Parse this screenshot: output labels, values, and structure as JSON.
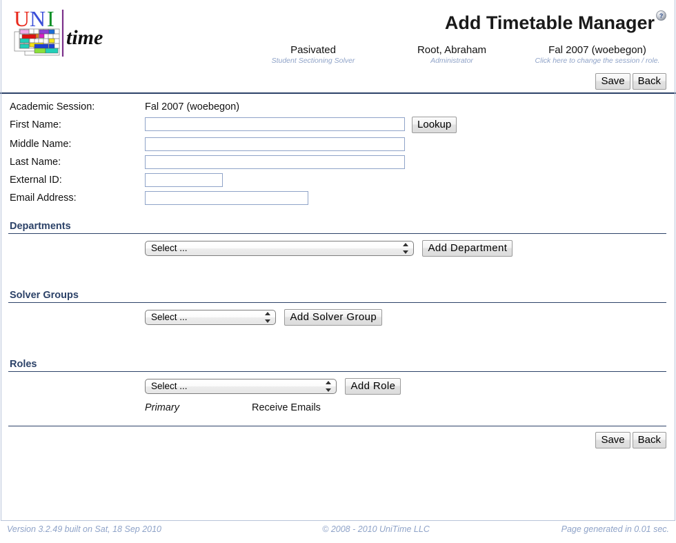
{
  "header": {
    "logo": {
      "word1": "UNI",
      "word2": "time",
      "alt": "unitime-logo"
    },
    "title": "Add Timetable Manager",
    "help_icon": "help-question-icon",
    "info": [
      {
        "main": "Pasivated",
        "sub": "Student Sectioning Solver"
      },
      {
        "main": "Root, Abraham",
        "sub": "Administrator"
      },
      {
        "main": "Fal 2007 (woebegon)",
        "sub": "Click here to change the session / role."
      }
    ]
  },
  "toolbar": {
    "save_label": "Save",
    "back_label": "Back"
  },
  "form": {
    "fields": [
      {
        "label": "Academic Session:",
        "type": "static",
        "value": "Fal 2007 (woebegon)"
      },
      {
        "label": "First Name:",
        "type": "text",
        "value": "",
        "placeholder": ""
      },
      {
        "label": "Middle Name:",
        "type": "text",
        "value": "",
        "placeholder": ""
      },
      {
        "label": "Last Name:",
        "type": "text",
        "value": "",
        "placeholder": ""
      },
      {
        "label": "External ID:",
        "type": "text",
        "value": "",
        "placeholder": ""
      },
      {
        "label": "Email Address:",
        "type": "text",
        "value": "",
        "placeholder": ""
      }
    ],
    "lookup_label": "Lookup"
  },
  "sections": {
    "departments": {
      "heading": "Departments",
      "select_value": "Select ...",
      "add_label": "Add Department"
    },
    "solver_groups": {
      "heading": "Solver Groups",
      "select_value": "Select ...",
      "add_label": "Add Solver Group"
    },
    "roles": {
      "heading": "Roles",
      "select_value": "Select ...",
      "add_label": "Add Role",
      "columns": {
        "primary": "Primary",
        "receive_emails": "Receive Emails"
      }
    }
  },
  "footer": {
    "version": "Version 3.2.49 built on Sat, 18 Sep 2010",
    "copyright": "© 2008 - 2010 UniTime LLC",
    "generated": "Page generated in 0.01 sec."
  },
  "colors": {
    "header_blue": "#2c4268",
    "muted_blue": "#8fa3c8",
    "frame_blue": "#b8c4d9"
  }
}
